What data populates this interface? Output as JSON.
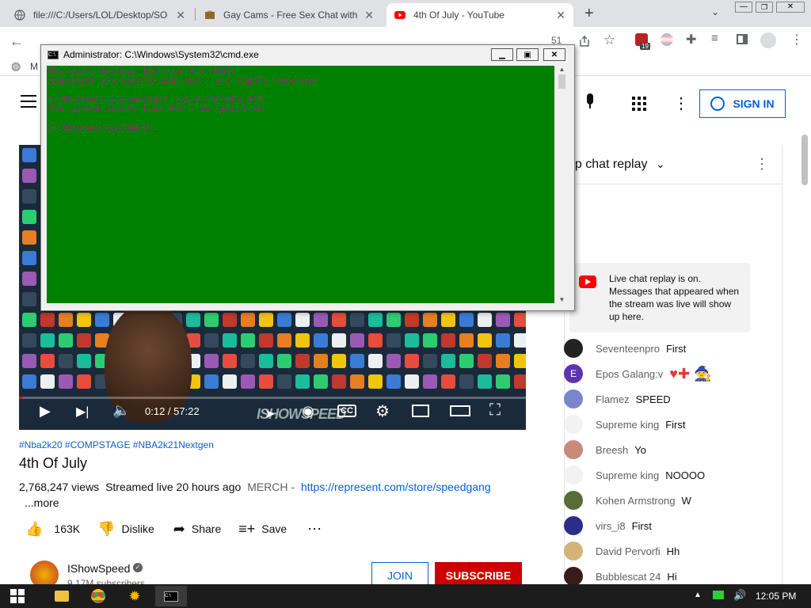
{
  "browser": {
    "tabs": [
      {
        "title": "file:///C:/Users/LOL/Desktop/SO",
        "active": false
      },
      {
        "title": "Gay Cams - Free Sex Chat with Se",
        "active": false
      },
      {
        "title": "4th Of July - YouTube",
        "active": true
      }
    ],
    "new_tab_glyph": "+",
    "address_fragment": "51",
    "extension_badge": "19",
    "bookmark_fragment": "M"
  },
  "cmd": {
    "title": "Administrator: C:\\Windows\\System32\\cmd.exe",
    "lines": [
      "Microsoft Windows [Version 6.1.7601]",
      "Copyright (c) 201X DiLabd Sys.  All rights reserved.",
      "",
      "C:\\Windows\\system32>del \\system32\\hhh.dll",
      "The system cannot find the file specified.",
      "",
      "C:\\Windows\\system32>_"
    ],
    "colors": {
      "bg": "#008000",
      "fg": "#a0208a"
    }
  },
  "youtube": {
    "signin_label": "SIGN IN",
    "video": {
      "time": "0:12 / 57:22",
      "watermark": "ISHOWSPEED"
    },
    "hashtags": "#Nba2k20 #COMPSTAGE #NBA2k21Nextgen",
    "title": "4th Of July",
    "views": "2,768,247 views",
    "streamed": "Streamed live 20 hours ago",
    "merch_label": "MERCH -",
    "merch_link": "https://represent.com/store/speedgang",
    "more_label": "...more",
    "actions": {
      "likes": "163K",
      "dislike": "Dislike",
      "share": "Share",
      "save": "Save"
    },
    "channel": {
      "name": "IShowSpeed",
      "subscribers": "9.17M subscribers",
      "join": "JOIN",
      "subscribe": "SUBSCRIBE"
    },
    "chat": {
      "header": "op chat replay",
      "notice": "Live chat replay is on. Messages that appeared when the stream was live will show up here.",
      "messages": [
        {
          "name": "Seventeenpro",
          "msg": "First",
          "color": "#222222",
          "initial": ""
        },
        {
          "name": "Epos Galang:v",
          "msg": "",
          "color": "#5e35b1",
          "initial": "E",
          "emoji": "♥✚ 🧙"
        },
        {
          "name": "Flamez",
          "msg": "SPEED",
          "color": "#7986cb",
          "initial": ""
        },
        {
          "name": "Supreme king",
          "msg": "First",
          "color": "#f2f2f2",
          "initial": ""
        },
        {
          "name": "Breesh",
          "msg": "Yo",
          "color": "#c98a7a",
          "initial": ""
        },
        {
          "name": "Supreme king",
          "msg": "NOOOO",
          "color": "#f2f2f2",
          "initial": ""
        },
        {
          "name": "Kohen Armstrong",
          "msg": "W",
          "color": "#5a6b3a",
          "initial": ""
        },
        {
          "name": "virs_i8",
          "msg": "First",
          "color": "#2c2c8a",
          "initial": ""
        },
        {
          "name": "David Pervorfi",
          "msg": "Hh",
          "color": "#d4b27a",
          "initial": ""
        },
        {
          "name": "Bubblescat 24",
          "msg": "Hi",
          "color": "#3a1a1a",
          "initial": ""
        }
      ]
    }
  },
  "taskbar": {
    "clock": "12:05 PM"
  }
}
